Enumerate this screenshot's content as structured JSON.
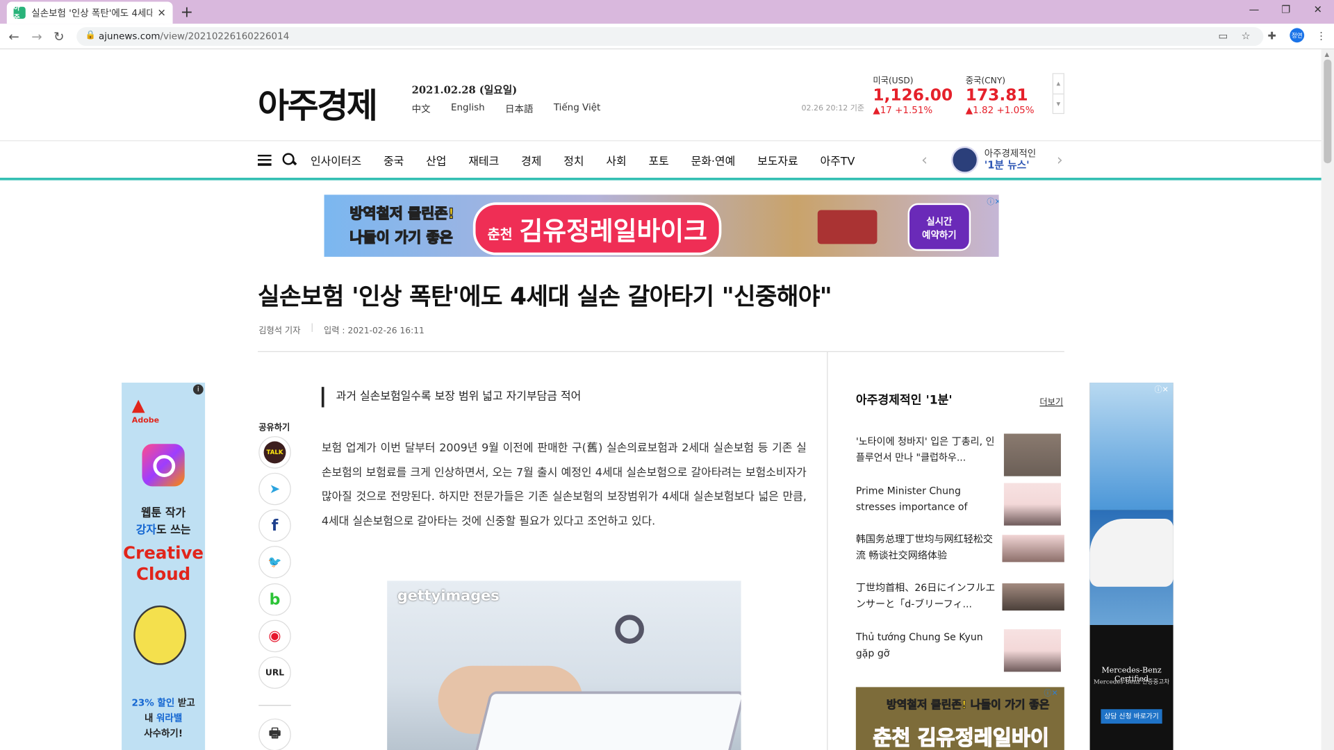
{
  "browser": {
    "tab_title": "실손보험 '인상 폭탄'에도 4세대",
    "tab_favicon": "아주",
    "url_host": "ajunews.com",
    "url_path": "/view/20210226160226014",
    "profile_initials": "정연"
  },
  "header": {
    "logo": "아주경제",
    "date": "2021.02.28 (일요일)",
    "languages": [
      "中文",
      "English",
      "日本語",
      "Tiếng Việt"
    ],
    "fx_time": "02.26 20:12 기준",
    "fx": [
      {
        "name": "미국(USD)",
        "value": "1,126.00",
        "change": "▲17  +1.51%"
      },
      {
        "name": "중국(CNY)",
        "value": "173.81",
        "change": "▲1.82  +1.05%"
      }
    ]
  },
  "nav": {
    "items": [
      "인사이터즈",
      "중국",
      "산업",
      "재테크",
      "경제",
      "정치",
      "사회",
      "포토",
      "문화·연예",
      "보도자료",
      "아주TV"
    ],
    "promo_line1": "아주경제적인",
    "promo_line2": "'1분 뉴스'"
  },
  "top_ad": {
    "line1a": "방역철저 ",
    "line1b": "클린존!",
    "line2a": "나들이 가기 ",
    "line2b": "좋은",
    "badge_small": "춘천",
    "badge_main": "김유정레일바이크",
    "reserve": "실시간\n예약하기"
  },
  "article": {
    "headline": "실손보험 '인상 폭탄'에도 4세대 실손 갈아타기 \"신중해야\"",
    "reporter": "김형석 기자",
    "published": "입력 : 2021-02-26 16:11",
    "subhead": "과거 실손보험일수록 보장 범위 넓고 자기부담금 적어",
    "body": "보험 업계가 이번 달부터 2009년 9월 이전에 판매한 구(舊) 실손의료보험과 2세대 실손보험 등 기존 실손보험의 보험료를 크게 인상하면서, 오는 7월 출시 예정인 4세대 실손보험으로 갈아타려는 보험소비자가 많아질 것으로 전망된다. 하지만 전문가들은 기존 실손보험의 보장범위가 4세대 실손보험보다 넓은 만큼, 4세대 실손보험으로 갈아타는 것에 신중할 필요가 있다고 조언하고 있다.",
    "photo_watermark": "gettyimages"
  },
  "share": {
    "label": "공유하기",
    "buttons": [
      {
        "name": "kakaotalk",
        "text": "TALK"
      },
      {
        "name": "telegram",
        "text": "➤"
      },
      {
        "name": "facebook",
        "text": "f"
      },
      {
        "name": "twitter",
        "text": "🐦"
      },
      {
        "name": "band",
        "text": "b"
      },
      {
        "name": "weibo",
        "text": "◉"
      },
      {
        "name": "url",
        "text": "URL"
      }
    ],
    "print": "🖶"
  },
  "sidebar": {
    "title": "아주경제적인 '1분'",
    "more": "더보기",
    "items": [
      "'노타이에 청바지' 입은 丁총리, 인플루언서 만나 \"클럽하우...",
      "Prime Minister Chung stresses importance of 'borderless...",
      "韩国务总理丁世均与网红轻松交流 畅谈社交网络体验",
      "丁世均首相、26日にインフルエンサーと「d-ブリーフィ...",
      "Thủ tướng Chung Se Kyun gặp gỡ influencer...\"Clubhouse là..."
    ],
    "ad_line1a": "방역철저 ",
    "ad_line1b": "클린존!",
    "ad_line1c": " 나들이 가기 ",
    "ad_line1d": "좋은",
    "ad_line2": "춘천 김유정레일바이크"
  },
  "left_ad": {
    "brand": "Adobe",
    "line1": "웹툰 작가",
    "line2a": "강자",
    "line2b": "도 쓰는",
    "product1": "Creative",
    "product2": "Cloud",
    "promo_a": "23% 할인",
    "promo_b": " 받고",
    "promo_c": "내 ",
    "promo_d": "워라밸",
    "promo_e": "사수하기!"
  },
  "right_ad": {
    "line1": "Mercedes-Benz Certified",
    "line2": "Mercedes-Benz 인증중고차",
    "button": "상담 신청 바로가기"
  }
}
